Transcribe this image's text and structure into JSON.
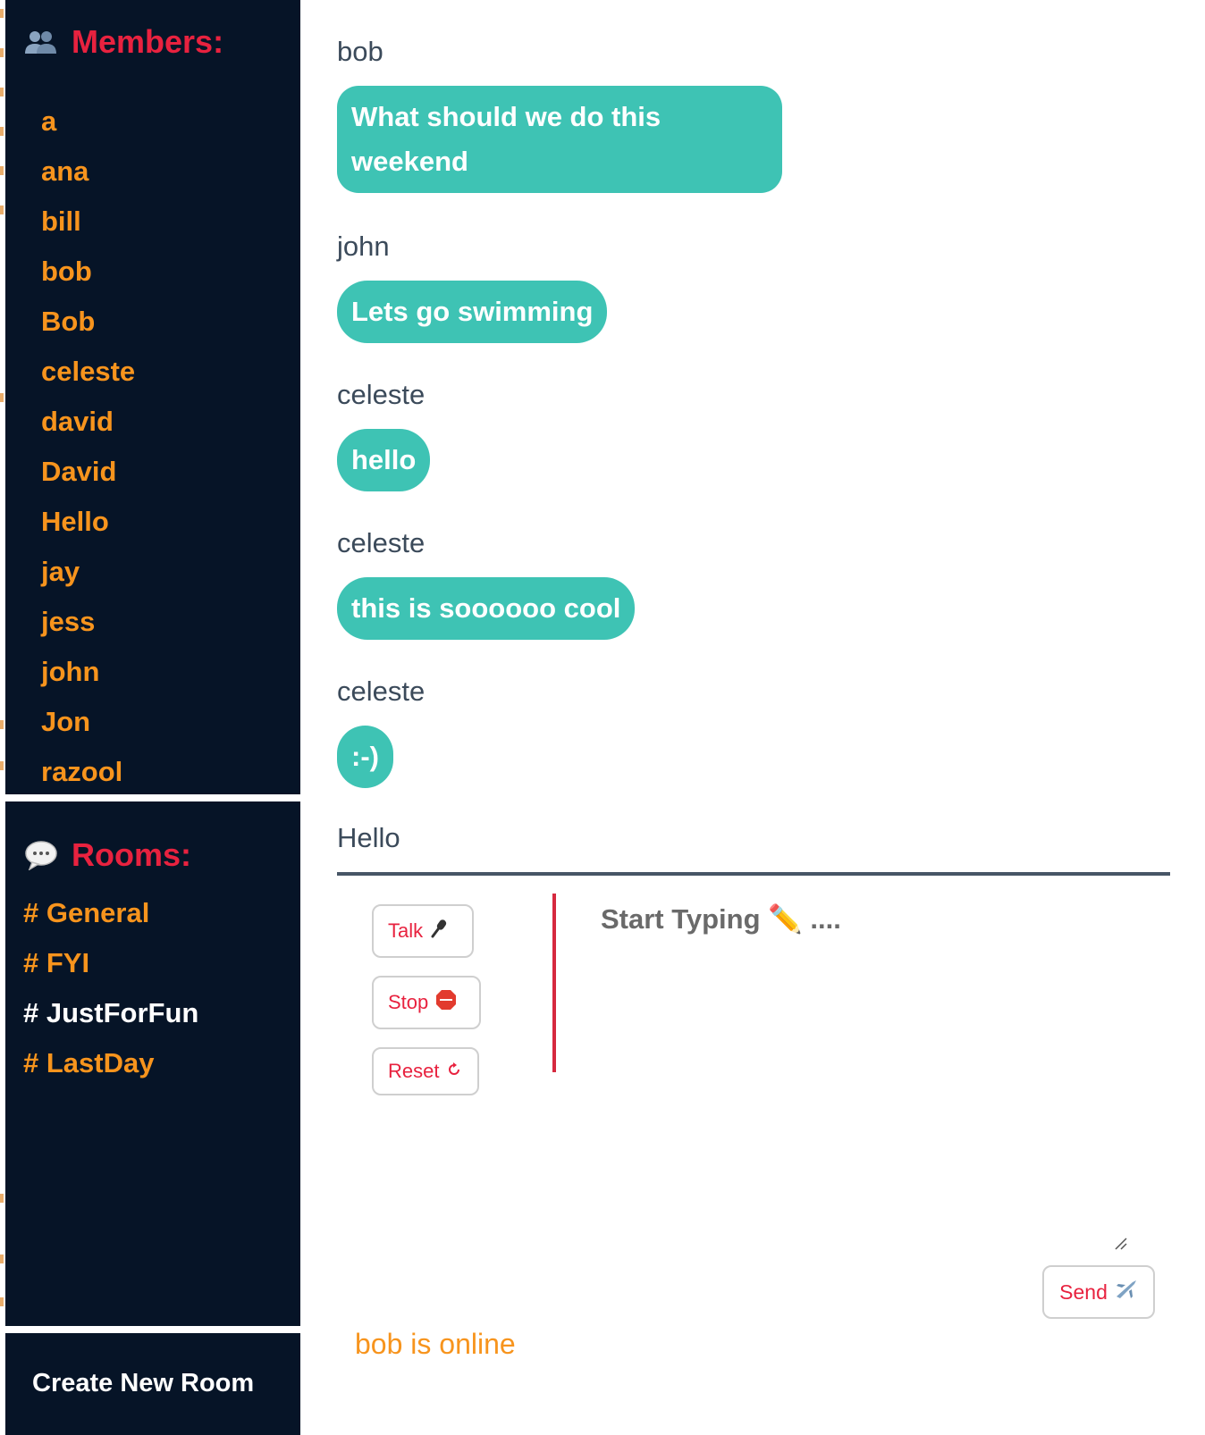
{
  "sidebar": {
    "members_title": "Members:",
    "members_icon": "busts-in-silhouette-icon",
    "members": [
      "a",
      "ana",
      "bill",
      "bob",
      "Bob",
      "celeste",
      "david",
      "David",
      "Hello",
      "jay",
      "jess",
      "john",
      "Jon",
      "razool"
    ],
    "rooms_title": "Rooms:",
    "rooms_icon": "speech-balloon-icon",
    "rooms": [
      {
        "label": "# General",
        "active": false
      },
      {
        "label": "# FYI",
        "active": false
      },
      {
        "label": "# JustForFun",
        "active": true
      },
      {
        "label": "# LastDay",
        "active": false
      }
    ],
    "create_room_label": "Create New Room"
  },
  "chat": {
    "messages": [
      {
        "author": "bob",
        "text": "What should we do this weekend"
      },
      {
        "author": "john",
        "text": "Lets go swimming"
      },
      {
        "author": "celeste",
        "text": "hello"
      },
      {
        "author": "celeste",
        "text": "this is soooooo cool"
      },
      {
        "author": "celeste",
        "text": ":-)"
      }
    ],
    "composer_author": "Hello"
  },
  "controls": {
    "talk_label": "Talk",
    "talk_icon": "microphone-icon",
    "stop_label": "Stop",
    "stop_icon": "stop-sign-icon",
    "reset_label": "Reset",
    "reset_icon": "refresh-icon"
  },
  "composer": {
    "placeholder": "Start Typing ✏️ ....",
    "send_label": "Send",
    "send_icon": "airplane-icon"
  },
  "status": {
    "text": "bob is online"
  },
  "colors": {
    "sidebar_bg": "#061427",
    "accent_red": "#e8223f",
    "member_orange": "#f7941d",
    "bubble_teal": "#3ec3b4",
    "author_gray": "#3b4a5a"
  }
}
